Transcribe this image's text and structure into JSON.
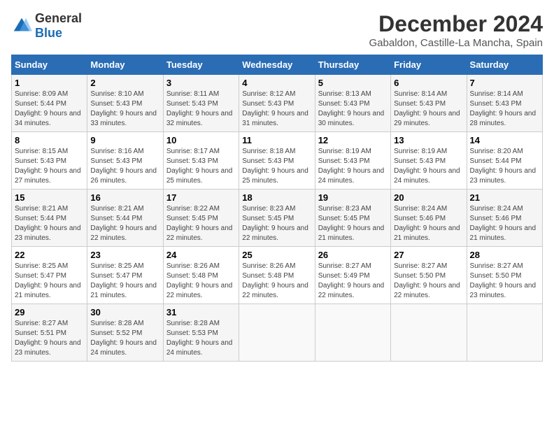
{
  "header": {
    "logo_general": "General",
    "logo_blue": "Blue",
    "month_title": "December 2024",
    "location": "Gabaldon, Castille-La Mancha, Spain"
  },
  "weekdays": [
    "Sunday",
    "Monday",
    "Tuesday",
    "Wednesday",
    "Thursday",
    "Friday",
    "Saturday"
  ],
  "weeks": [
    [
      {
        "day": "1",
        "sunrise": "Sunrise: 8:09 AM",
        "sunset": "Sunset: 5:44 PM",
        "daylight": "Daylight: 9 hours and 34 minutes."
      },
      {
        "day": "2",
        "sunrise": "Sunrise: 8:10 AM",
        "sunset": "Sunset: 5:43 PM",
        "daylight": "Daylight: 9 hours and 33 minutes."
      },
      {
        "day": "3",
        "sunrise": "Sunrise: 8:11 AM",
        "sunset": "Sunset: 5:43 PM",
        "daylight": "Daylight: 9 hours and 32 minutes."
      },
      {
        "day": "4",
        "sunrise": "Sunrise: 8:12 AM",
        "sunset": "Sunset: 5:43 PM",
        "daylight": "Daylight: 9 hours and 31 minutes."
      },
      {
        "day": "5",
        "sunrise": "Sunrise: 8:13 AM",
        "sunset": "Sunset: 5:43 PM",
        "daylight": "Daylight: 9 hours and 30 minutes."
      },
      {
        "day": "6",
        "sunrise": "Sunrise: 8:14 AM",
        "sunset": "Sunset: 5:43 PM",
        "daylight": "Daylight: 9 hours and 29 minutes."
      },
      {
        "day": "7",
        "sunrise": "Sunrise: 8:14 AM",
        "sunset": "Sunset: 5:43 PM",
        "daylight": "Daylight: 9 hours and 28 minutes."
      }
    ],
    [
      {
        "day": "8",
        "sunrise": "Sunrise: 8:15 AM",
        "sunset": "Sunset: 5:43 PM",
        "daylight": "Daylight: 9 hours and 27 minutes."
      },
      {
        "day": "9",
        "sunrise": "Sunrise: 8:16 AM",
        "sunset": "Sunset: 5:43 PM",
        "daylight": "Daylight: 9 hours and 26 minutes."
      },
      {
        "day": "10",
        "sunrise": "Sunrise: 8:17 AM",
        "sunset": "Sunset: 5:43 PM",
        "daylight": "Daylight: 9 hours and 25 minutes."
      },
      {
        "day": "11",
        "sunrise": "Sunrise: 8:18 AM",
        "sunset": "Sunset: 5:43 PM",
        "daylight": "Daylight: 9 hours and 25 minutes."
      },
      {
        "day": "12",
        "sunrise": "Sunrise: 8:19 AM",
        "sunset": "Sunset: 5:43 PM",
        "daylight": "Daylight: 9 hours and 24 minutes."
      },
      {
        "day": "13",
        "sunrise": "Sunrise: 8:19 AM",
        "sunset": "Sunset: 5:43 PM",
        "daylight": "Daylight: 9 hours and 24 minutes."
      },
      {
        "day": "14",
        "sunrise": "Sunrise: 8:20 AM",
        "sunset": "Sunset: 5:44 PM",
        "daylight": "Daylight: 9 hours and 23 minutes."
      }
    ],
    [
      {
        "day": "15",
        "sunrise": "Sunrise: 8:21 AM",
        "sunset": "Sunset: 5:44 PM",
        "daylight": "Daylight: 9 hours and 23 minutes."
      },
      {
        "day": "16",
        "sunrise": "Sunrise: 8:21 AM",
        "sunset": "Sunset: 5:44 PM",
        "daylight": "Daylight: 9 hours and 22 minutes."
      },
      {
        "day": "17",
        "sunrise": "Sunrise: 8:22 AM",
        "sunset": "Sunset: 5:45 PM",
        "daylight": "Daylight: 9 hours and 22 minutes."
      },
      {
        "day": "18",
        "sunrise": "Sunrise: 8:23 AM",
        "sunset": "Sunset: 5:45 PM",
        "daylight": "Daylight: 9 hours and 22 minutes."
      },
      {
        "day": "19",
        "sunrise": "Sunrise: 8:23 AM",
        "sunset": "Sunset: 5:45 PM",
        "daylight": "Daylight: 9 hours and 21 minutes."
      },
      {
        "day": "20",
        "sunrise": "Sunrise: 8:24 AM",
        "sunset": "Sunset: 5:46 PM",
        "daylight": "Daylight: 9 hours and 21 minutes."
      },
      {
        "day": "21",
        "sunrise": "Sunrise: 8:24 AM",
        "sunset": "Sunset: 5:46 PM",
        "daylight": "Daylight: 9 hours and 21 minutes."
      }
    ],
    [
      {
        "day": "22",
        "sunrise": "Sunrise: 8:25 AM",
        "sunset": "Sunset: 5:47 PM",
        "daylight": "Daylight: 9 hours and 21 minutes."
      },
      {
        "day": "23",
        "sunrise": "Sunrise: 8:25 AM",
        "sunset": "Sunset: 5:47 PM",
        "daylight": "Daylight: 9 hours and 21 minutes."
      },
      {
        "day": "24",
        "sunrise": "Sunrise: 8:26 AM",
        "sunset": "Sunset: 5:48 PM",
        "daylight": "Daylight: 9 hours and 22 minutes."
      },
      {
        "day": "25",
        "sunrise": "Sunrise: 8:26 AM",
        "sunset": "Sunset: 5:48 PM",
        "daylight": "Daylight: 9 hours and 22 minutes."
      },
      {
        "day": "26",
        "sunrise": "Sunrise: 8:27 AM",
        "sunset": "Sunset: 5:49 PM",
        "daylight": "Daylight: 9 hours and 22 minutes."
      },
      {
        "day": "27",
        "sunrise": "Sunrise: 8:27 AM",
        "sunset": "Sunset: 5:50 PM",
        "daylight": "Daylight: 9 hours and 22 minutes."
      },
      {
        "day": "28",
        "sunrise": "Sunrise: 8:27 AM",
        "sunset": "Sunset: 5:50 PM",
        "daylight": "Daylight: 9 hours and 23 minutes."
      }
    ],
    [
      {
        "day": "29",
        "sunrise": "Sunrise: 8:27 AM",
        "sunset": "Sunset: 5:51 PM",
        "daylight": "Daylight: 9 hours and 23 minutes."
      },
      {
        "day": "30",
        "sunrise": "Sunrise: 8:28 AM",
        "sunset": "Sunset: 5:52 PM",
        "daylight": "Daylight: 9 hours and 24 minutes."
      },
      {
        "day": "31",
        "sunrise": "Sunrise: 8:28 AM",
        "sunset": "Sunset: 5:53 PM",
        "daylight": "Daylight: 9 hours and 24 minutes."
      },
      null,
      null,
      null,
      null
    ]
  ]
}
